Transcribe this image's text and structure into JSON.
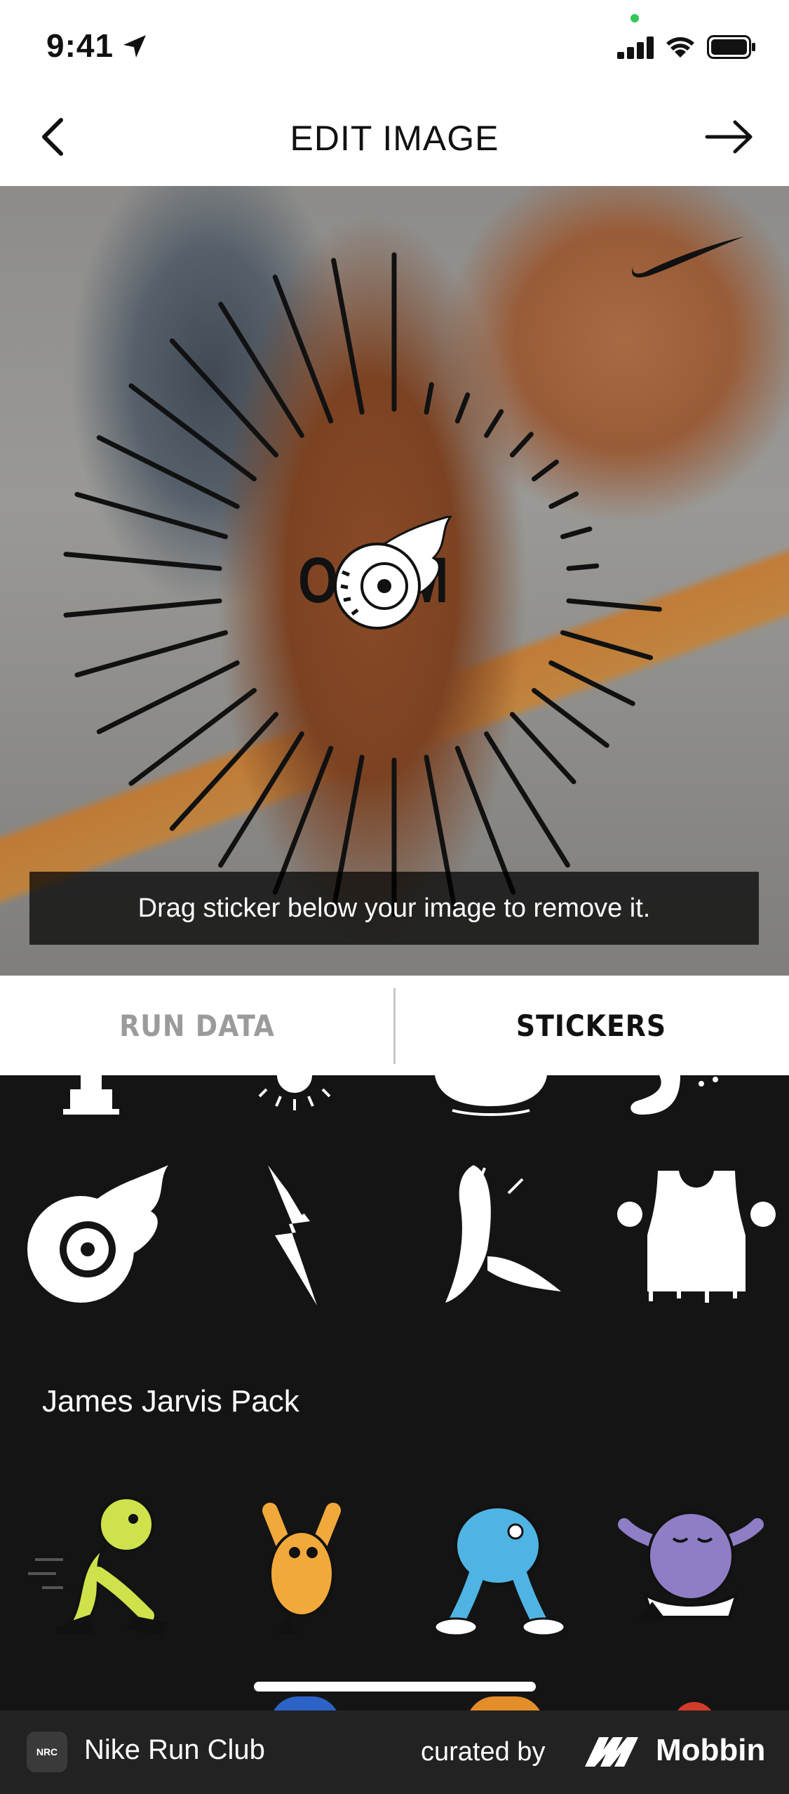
{
  "status_bar": {
    "time": "9:41"
  },
  "header": {
    "title": "EDIT IMAGE"
  },
  "photo": {
    "sticker_text": "OM",
    "hint": "Drag sticker below your image to remove it."
  },
  "tabs": [
    {
      "label": "RUN DATA",
      "selected": false
    },
    {
      "label": "STICKERS",
      "selected": true
    }
  ],
  "tray": {
    "pack_title": "James Jarvis Pack",
    "top_row_icons": [
      "trophy-icon",
      "sun-icon",
      "bowl-icon",
      "foot-icon"
    ],
    "nike_pack_icons": [
      "flaming-tire-sticker",
      "lightning-bolt-sticker",
      "banana-sticker",
      "tank-top-sticker"
    ],
    "jarvis_colors": [
      "#cfe24b",
      "#f2a93b",
      "#4fb4e4",
      "#8f7ec6"
    ]
  },
  "footer": {
    "app_icon_text": "NRC",
    "app_name": "Nike Run Club",
    "curated_by": "curated by",
    "brand": "Mobbin"
  }
}
